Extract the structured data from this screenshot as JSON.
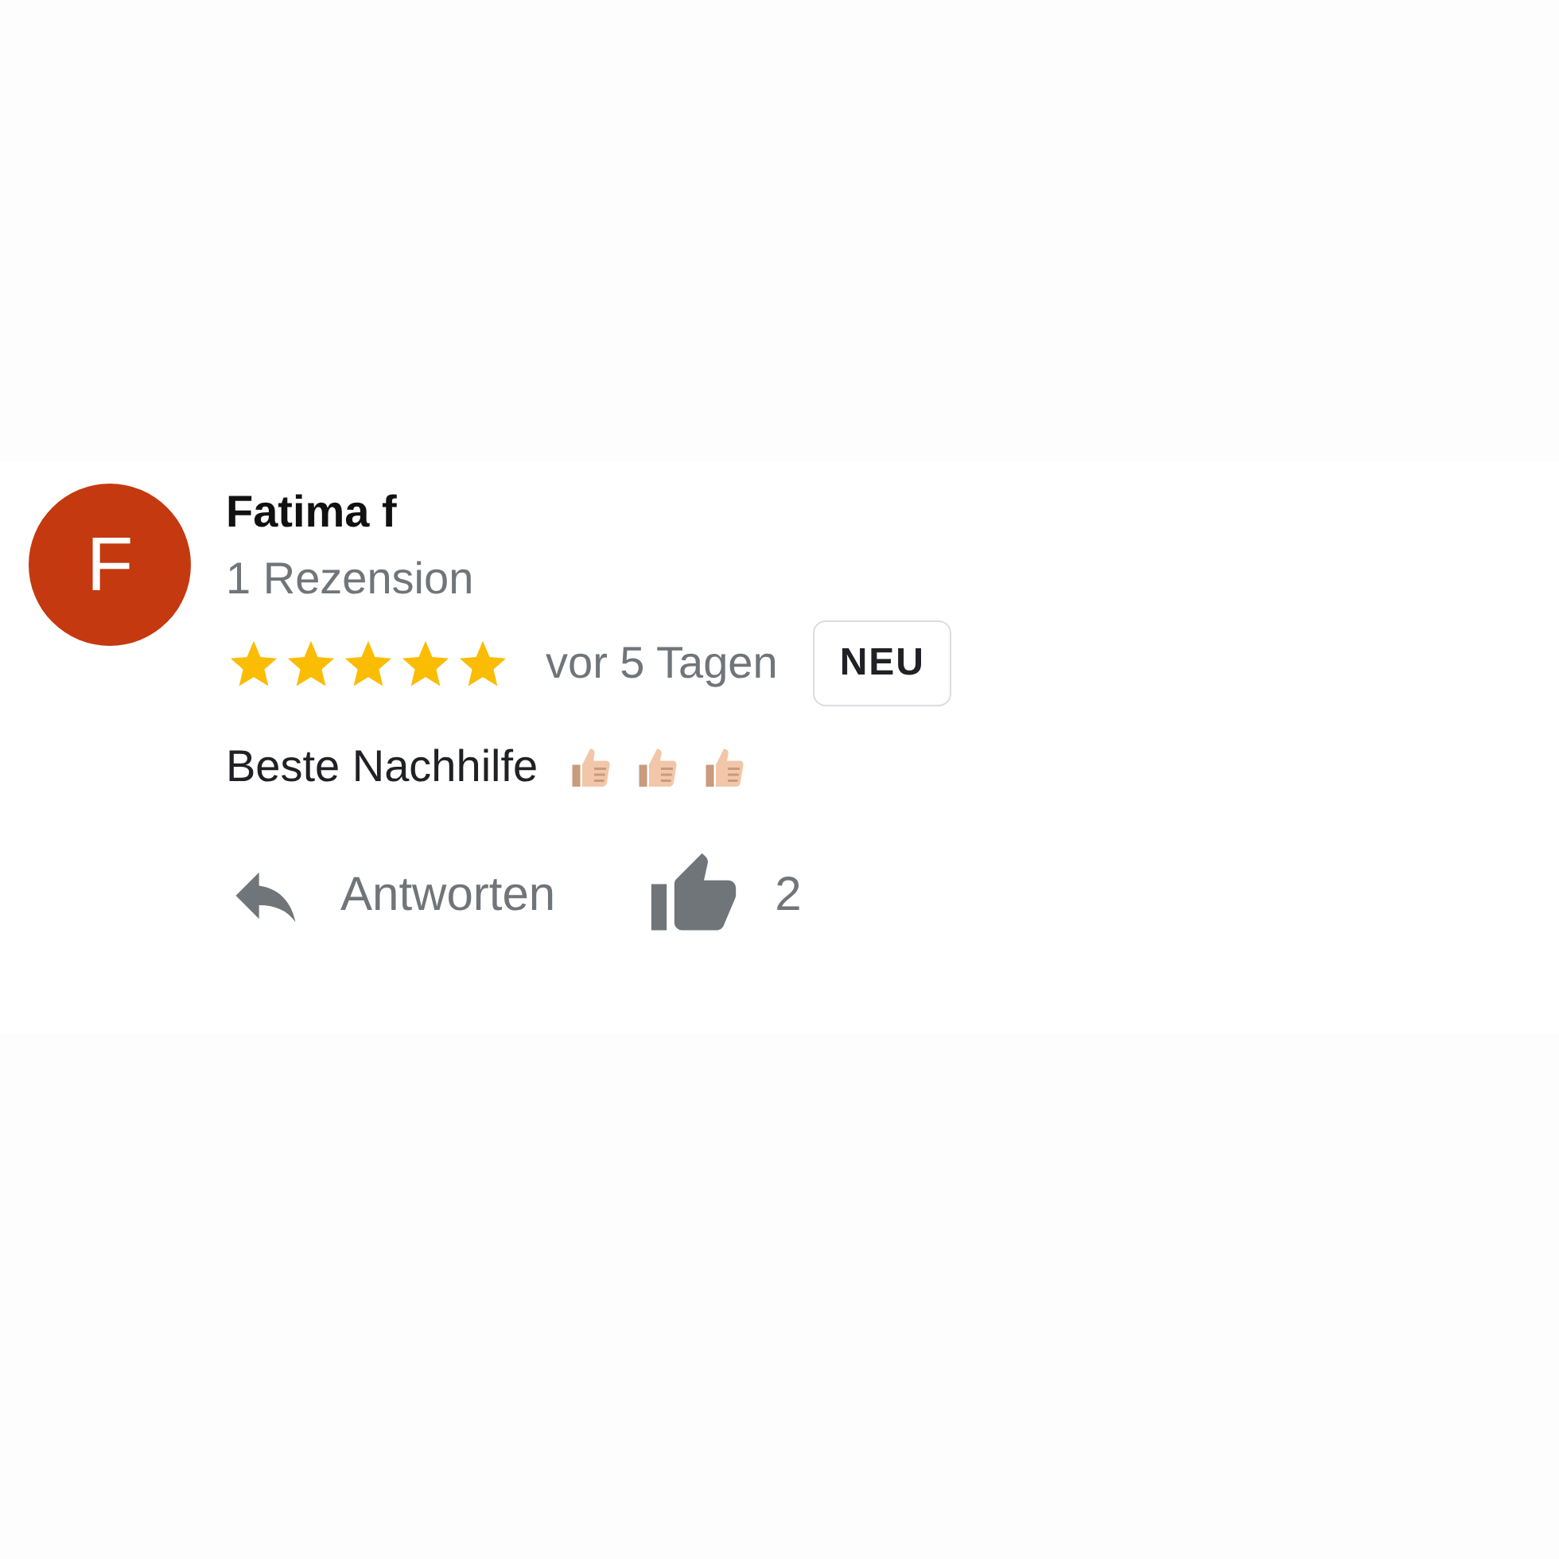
{
  "review": {
    "avatar_letter": "F",
    "author": "Fatima f",
    "review_count": "1 Rezension",
    "stars": 5,
    "time": "vor 5 Tagen",
    "badge": "NEU",
    "text": "Beste Nachhilfe",
    "emoji": [
      {
        "kind": "thumbs-up"
      },
      {
        "kind": "thumbs-up"
      },
      {
        "kind": "thumbs-up"
      }
    ],
    "reply_label": "Antworten",
    "like_count": "2"
  }
}
